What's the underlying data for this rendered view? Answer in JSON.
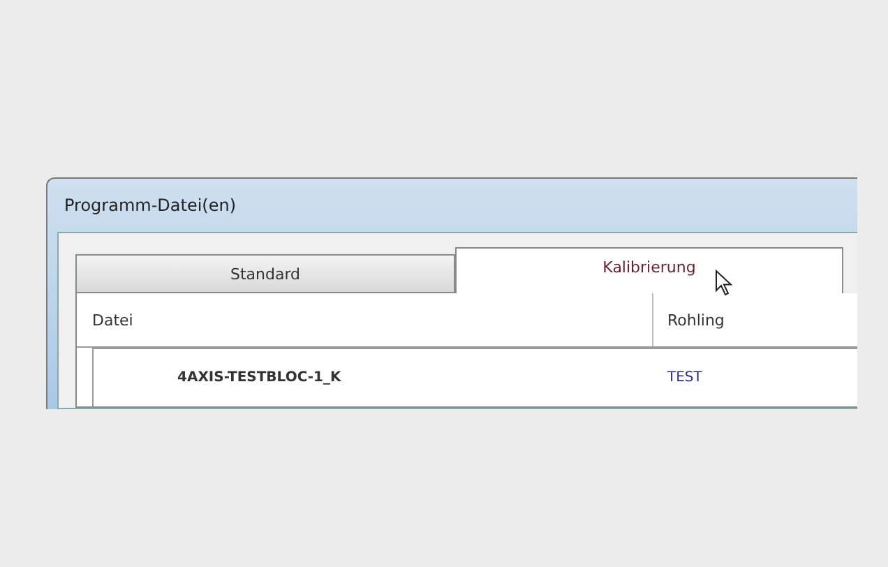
{
  "window": {
    "title": "Programm-Datei(en)"
  },
  "tabs": [
    {
      "label": "Standard",
      "selected": false
    },
    {
      "label": "Kalibrierung",
      "selected": true
    }
  ],
  "table": {
    "columns": [
      "Datei",
      "Rohling"
    ],
    "rows": [
      {
        "cells": [
          "4AXIS-TESTBLOC-1_K",
          "TEST"
        ]
      }
    ]
  }
}
